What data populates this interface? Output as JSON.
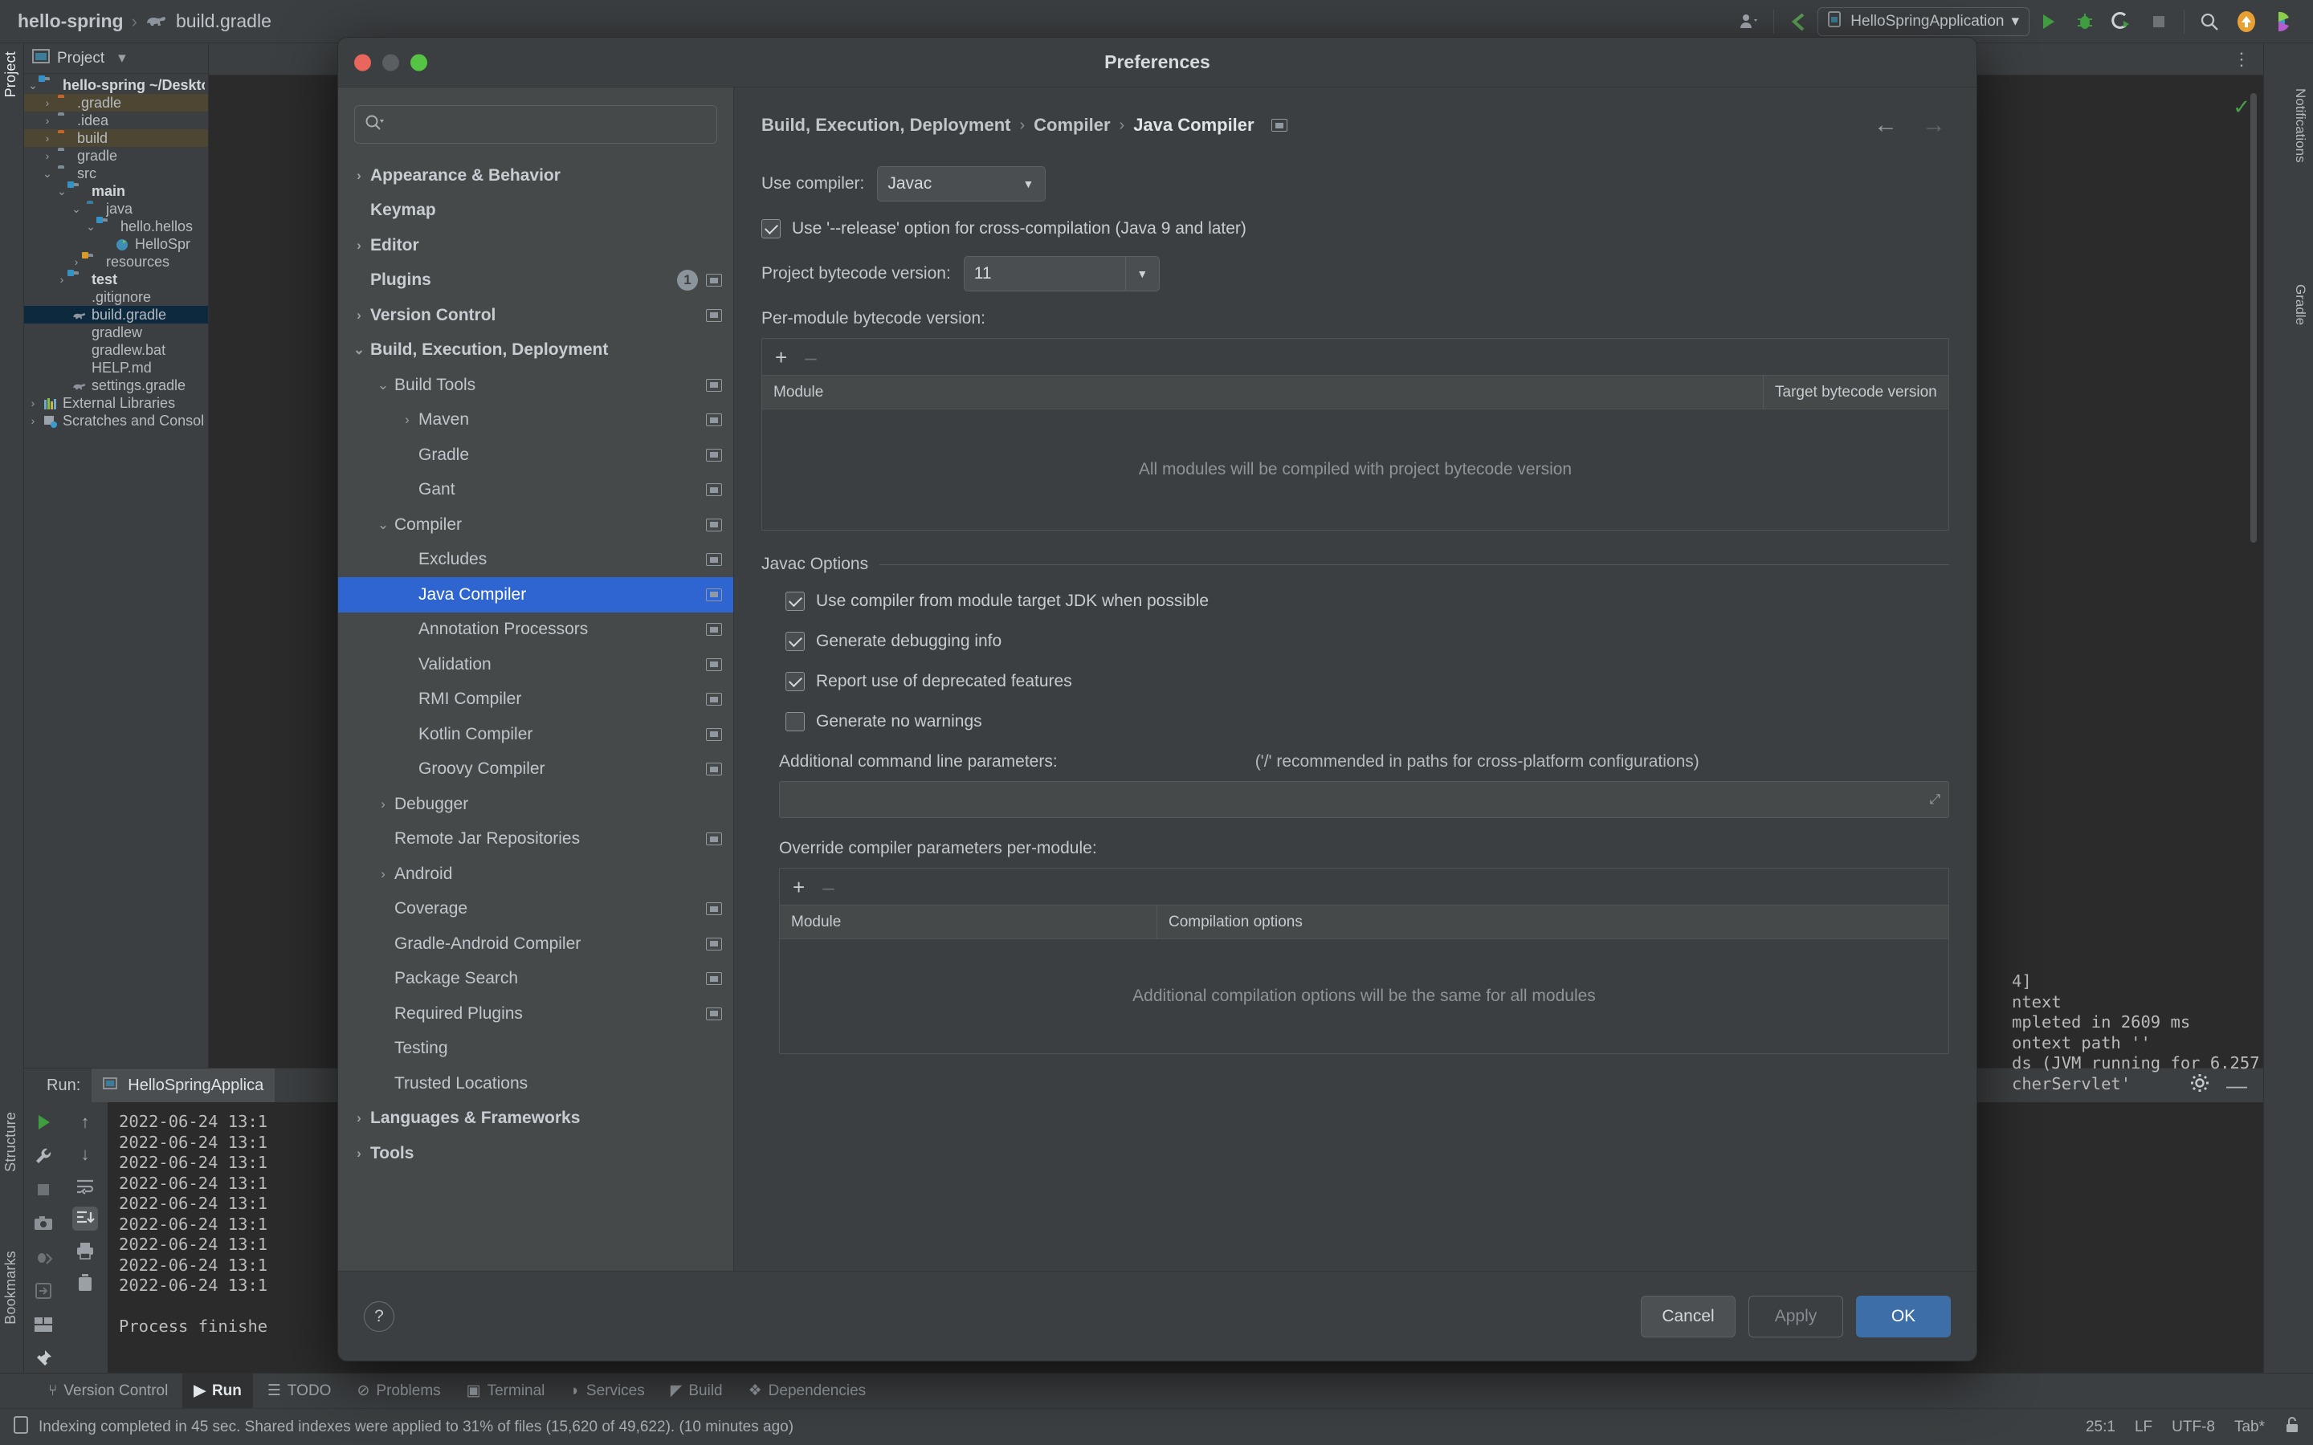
{
  "ide": {
    "breadcrumb": {
      "project": "hello-spring",
      "separator": "›",
      "file": "build.gradle",
      "file_icon": "gradle-elephant-icon"
    },
    "toolbar_right": {
      "account_icon": "user-account-icon",
      "vcs_update_icon": "vcs-update-icon",
      "run_config": "HelloSpringApplication",
      "run_icon": "run-icon",
      "debug_icon": "debug-icon",
      "run_coverage_icon": "run-with-coverage-icon",
      "stop_icon": "stop-icon",
      "search_icon": "search-everywhere-icon",
      "updates_icon": "updates-available-icon",
      "ai_icon": "ai-assistant-icon"
    },
    "left_tabs": [
      {
        "label": "Project",
        "active": true
      }
    ],
    "right_tabs": [
      {
        "label": "Notifications"
      },
      {
        "label": "Gradle"
      }
    ],
    "bottom_left_tabs": [
      {
        "label": "Structure"
      },
      {
        "label": "Bookmarks"
      }
    ],
    "project_panel": {
      "title": "Project",
      "chevron": "▾",
      "tree": [
        {
          "label": "hello-spring",
          "suffix": " ~/Deskto",
          "depth": 0,
          "arrow": "⌄",
          "icon": "module-folder-icon",
          "bold": true
        },
        {
          "label": ".gradle",
          "depth": 1,
          "arrow": "›",
          "icon": "folder-orange-icon",
          "highlight": "yellow"
        },
        {
          "label": ".idea",
          "depth": 1,
          "arrow": "›",
          "icon": "folder-icon"
        },
        {
          "label": "build",
          "depth": 1,
          "arrow": "›",
          "icon": "folder-orange-icon",
          "highlight": "yellow"
        },
        {
          "label": "gradle",
          "depth": 1,
          "arrow": "›",
          "icon": "folder-icon"
        },
        {
          "label": "src",
          "depth": 1,
          "arrow": "⌄",
          "icon": "folder-icon"
        },
        {
          "label": "main",
          "depth": 2,
          "arrow": "⌄",
          "icon": "source-root-folder-icon",
          "bold": true
        },
        {
          "label": "java",
          "depth": 3,
          "arrow": "⌄",
          "icon": "folder-blue-icon"
        },
        {
          "label": "hello.hellos",
          "depth": 4,
          "arrow": "⌄",
          "icon": "package-folder-icon"
        },
        {
          "label": "HelloSpr",
          "depth": 5,
          "arrow": "",
          "icon": "spring-class-icon"
        },
        {
          "label": "resources",
          "depth": 3,
          "arrow": "›",
          "icon": "resources-folder-icon"
        },
        {
          "label": "test",
          "depth": 2,
          "arrow": "›",
          "icon": "test-folder-icon",
          "bold": true
        },
        {
          "label": ".gitignore",
          "depth": 2,
          "arrow": "",
          "icon": "gitignore-file-icon"
        },
        {
          "label": "build.gradle",
          "depth": 2,
          "arrow": "",
          "icon": "gradle-elephant-icon",
          "selected": true
        },
        {
          "label": "gradlew",
          "depth": 2,
          "arrow": "",
          "icon": "shell-script-icon"
        },
        {
          "label": "gradlew.bat",
          "depth": 2,
          "arrow": "",
          "icon": "batch-file-icon"
        },
        {
          "label": "HELP.md",
          "depth": 2,
          "arrow": "",
          "icon": "markdown-file-icon"
        },
        {
          "label": "settings.gradle",
          "depth": 2,
          "arrow": "",
          "icon": "gradle-elephant-icon"
        },
        {
          "label": "External Libraries",
          "depth": 0,
          "arrow": "›",
          "icon": "external-libraries-icon"
        },
        {
          "label": "Scratches and Console",
          "depth": 0,
          "arrow": "›",
          "icon": "scratches-icon"
        }
      ]
    },
    "run_window": {
      "title": "Run:",
      "tab": "HelloSpringApplica",
      "tab_icon": "run-config-icon",
      "gutter_icons": [
        "rerun-icon",
        "wrench-icon",
        "stop-icon",
        "camera-icon",
        "debug-dump-icon",
        "export-icon",
        "layout-icon",
        "pin-icon"
      ],
      "gutter2_icons": [
        "up-arrow-icon",
        "down-arrow-icon",
        "soft-wrap-icon",
        "scroll-to-end-icon",
        "print-icon",
        "trash-icon"
      ],
      "settings_icon": "gear-icon",
      "minimize_icon": "minimize-icon",
      "console_lines": [
        "2022-06-24 13:1",
        "2022-06-24 13:1",
        "2022-06-24 13:1",
        "2022-06-24 13:1",
        "2022-06-24 13:1",
        "2022-06-24 13:1",
        "2022-06-24 13:1",
        "2022-06-24 13:1",
        "2022-06-24 13:1",
        "",
        "Process finishe"
      ],
      "console_lines_right": [
        "4]",
        "ntext",
        "mpleted in 2609 ms",
        "ontext path ''",
        "ds (JVM running for 6.257",
        "cherServlet'"
      ]
    },
    "bottom_tabs": [
      {
        "label": "Version Control",
        "icon": "branch-icon",
        "active": false
      },
      {
        "label": "Run",
        "icon": "run-icon",
        "active": true
      },
      {
        "label": "TODO",
        "icon": "todo-icon",
        "active": false
      },
      {
        "label": "Problems",
        "icon": "problems-icon",
        "active": false
      },
      {
        "label": "Terminal",
        "icon": "terminal-icon",
        "active": false
      },
      {
        "label": "Services",
        "icon": "services-icon",
        "active": false
      },
      {
        "label": "Build",
        "icon": "build-icon",
        "active": false
      },
      {
        "label": "Dependencies",
        "icon": "dependencies-icon",
        "active": false
      }
    ],
    "status_bar": {
      "icon": "indexing-icon",
      "message": "Indexing completed in 45 sec. Shared indexes were applied to 31% of files (15,620 of 49,622). (10 minutes ago)",
      "caret_position": "25:1",
      "line_separator": "LF",
      "encoding": "UTF-8",
      "indent": "Tab*",
      "lock_icon": "lock-icon"
    }
  },
  "dialog": {
    "title": "Preferences",
    "traffic_lights": {
      "close": "close-button",
      "minimize": "minimize-button",
      "zoom": "zoom-button"
    },
    "search": {
      "placeholder": "",
      "value": "",
      "icon": "search-icon"
    },
    "tree": [
      {
        "label": "Appearance & Behavior",
        "depth": 0,
        "twisty": "›",
        "bold": true
      },
      {
        "label": "Keymap",
        "depth": 0,
        "twisty": "",
        "bold": true
      },
      {
        "label": "Editor",
        "depth": 0,
        "twisty": "›",
        "bold": true
      },
      {
        "label": "Plugins",
        "depth": 0,
        "twisty": "",
        "bold": true,
        "badge": "1",
        "project_mark": true
      },
      {
        "label": "Version Control",
        "depth": 0,
        "twisty": "›",
        "bold": true,
        "project_mark": true
      },
      {
        "label": "Build, Execution, Deployment",
        "depth": 0,
        "twisty": "⌄",
        "bold": true
      },
      {
        "label": "Build Tools",
        "depth": 1,
        "twisty": "⌄",
        "project_mark": true
      },
      {
        "label": "Maven",
        "depth": 2,
        "twisty": "›",
        "project_mark": true
      },
      {
        "label": "Gradle",
        "depth": 2,
        "twisty": "",
        "project_mark": true
      },
      {
        "label": "Gant",
        "depth": 2,
        "twisty": "",
        "project_mark": true
      },
      {
        "label": "Compiler",
        "depth": 1,
        "twisty": "⌄",
        "project_mark": true
      },
      {
        "label": "Excludes",
        "depth": 2,
        "twisty": "",
        "project_mark": true
      },
      {
        "label": "Java Compiler",
        "depth": 2,
        "twisty": "",
        "selected": true,
        "project_mark": true
      },
      {
        "label": "Annotation Processors",
        "depth": 2,
        "twisty": "",
        "project_mark": true
      },
      {
        "label": "Validation",
        "depth": 2,
        "twisty": "",
        "project_mark": true
      },
      {
        "label": "RMI Compiler",
        "depth": 2,
        "twisty": "",
        "project_mark": true
      },
      {
        "label": "Kotlin Compiler",
        "depth": 2,
        "twisty": "",
        "project_mark": true
      },
      {
        "label": "Groovy Compiler",
        "depth": 2,
        "twisty": "",
        "project_mark": true
      },
      {
        "label": "Debugger",
        "depth": 1,
        "twisty": "›"
      },
      {
        "label": "Remote Jar Repositories",
        "depth": 1,
        "twisty": "",
        "project_mark": true
      },
      {
        "label": "Android",
        "depth": 1,
        "twisty": "›"
      },
      {
        "label": "Coverage",
        "depth": 1,
        "twisty": "",
        "project_mark": true
      },
      {
        "label": "Gradle-Android Compiler",
        "depth": 1,
        "twisty": "",
        "project_mark": true
      },
      {
        "label": "Package Search",
        "depth": 1,
        "twisty": "",
        "project_mark": true
      },
      {
        "label": "Required Plugins",
        "depth": 1,
        "twisty": "",
        "project_mark": true
      },
      {
        "label": "Testing",
        "depth": 1,
        "twisty": ""
      },
      {
        "label": "Trusted Locations",
        "depth": 1,
        "twisty": ""
      },
      {
        "label": "Languages & Frameworks",
        "depth": 0,
        "twisty": "›",
        "bold": true
      },
      {
        "label": "Tools",
        "depth": 0,
        "twisty": "›",
        "bold": true
      }
    ],
    "breadcrumb": {
      "part1": "Build, Execution, Deployment",
      "part2": "Compiler",
      "part3": "Java Compiler",
      "separator": "›",
      "project_mark_icon": "project-scope-icon",
      "back_icon": "←",
      "forward_icon": "→"
    },
    "content": {
      "use_compiler_label": "Use compiler:",
      "use_compiler_value": "Javac",
      "release_option_label": "Use '--release' option for cross-compilation (Java 9 and later)",
      "release_option_checked": true,
      "project_bytecode_label": "Project bytecode version:",
      "project_bytecode_value": "11",
      "per_module_label": "Per-module bytecode version:",
      "per_module_table": {
        "add_icon": "+",
        "remove_icon": "–",
        "columns": [
          "Module",
          "Target bytecode version"
        ],
        "rows": [],
        "empty_text": "All modules will be compiled with project bytecode version"
      },
      "javac_group_title": "Javac Options",
      "javac_options": [
        {
          "label": "Use compiler from module target JDK when possible",
          "checked": true
        },
        {
          "label": "Generate debugging info",
          "checked": true
        },
        {
          "label": "Report use of deprecated features",
          "checked": true
        },
        {
          "label": "Generate no warnings",
          "checked": false
        }
      ],
      "additional_params_label": "Additional command line parameters:",
      "additional_params_hint": "('/' recommended in paths for cross-platform configurations)",
      "additional_params_value": "",
      "expand_icon": "expand-editor-icon",
      "override_label": "Override compiler parameters per-module:",
      "override_table": {
        "add_icon": "+",
        "remove_icon": "–",
        "columns": [
          "Module",
          "Compilation options"
        ],
        "rows": [],
        "empty_text": "Additional compilation options will be the same for all modules"
      }
    },
    "footer": {
      "help_label": "?",
      "cancel_label": "Cancel",
      "apply_label": "Apply",
      "ok_label": "OK"
    }
  },
  "colors": {
    "accent_blue": "#2f65d0",
    "primary_button": "#3e6ea8",
    "dialog_bg": "#3c3f41",
    "tree_pane_bg": "#45494a",
    "console_bg": "#2b2b2b",
    "selection_yellow": "#4d4632",
    "file_selected": "#0d293e"
  }
}
